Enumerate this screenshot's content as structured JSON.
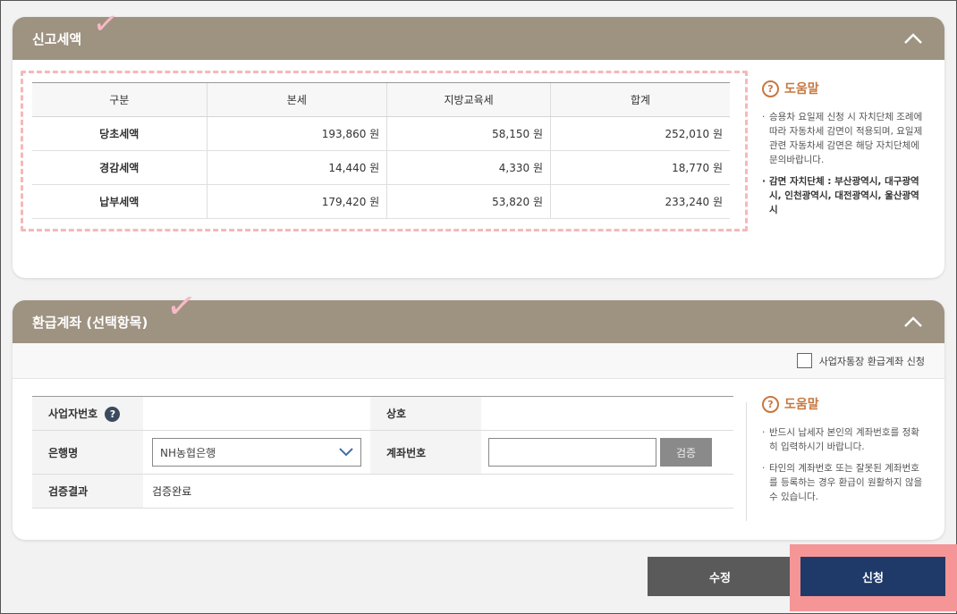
{
  "tax_section": {
    "title": "신고세액",
    "columns": [
      "구분",
      "본세",
      "지방교육세",
      "합계"
    ],
    "rows": [
      {
        "label": "당초세액",
        "main": "193,860 원",
        "edu": "58,150 원",
        "total": "252,010 원"
      },
      {
        "label": "경감세액",
        "main": "14,440 원",
        "edu": "4,330 원",
        "total": "18,770 원"
      },
      {
        "label": "납부세액",
        "main": "179,420 원",
        "edu": "53,820 원",
        "total": "233,240 원"
      }
    ],
    "help": {
      "title": "도움말",
      "items": [
        "승용차 요일제 신청 시 자치단체 조례에 따라 자동차세 감면이 적용되며, 요일제 관련 자동차세 감면은 해당 자치단체에 문의바랍니다.",
        "감면 자치단체 : 부산광역시, 대구광역시, 인천광역시, 대전광역시, 울산광역시"
      ]
    }
  },
  "refund_section": {
    "title": "환급계좌 (선택항목)",
    "business_checkbox_label": "사업자통장 환급계좌 신청",
    "fields": {
      "business_no_label": "사업자번호",
      "company_label": "상호",
      "bank_label": "은행명",
      "bank_value": "NH농협은행",
      "account_label": "계좌번호",
      "verify_button": "검증",
      "result_label": "검증결과",
      "result_value": "검증완료"
    },
    "help": {
      "title": "도움말",
      "items": [
        "반드시 납세자 본인의 계좌번호를 정확히 입력하시기 바랍니다.",
        "타인의 계좌번호 또는 잘못된 계좌번호를 등록하는 경우 환급이 원활하지 않을 수 있습니다."
      ]
    }
  },
  "buttons": {
    "edit": "수정",
    "apply": "신청"
  },
  "glyphs": {
    "check": "✓",
    "question": "?",
    "help_question": "?"
  },
  "colors": {
    "header": "#9e9281",
    "help_accent": "#c7773f",
    "apply_button": "#1f3a68",
    "edit_button": "#5a5a5a",
    "highlight": "#f59596"
  }
}
